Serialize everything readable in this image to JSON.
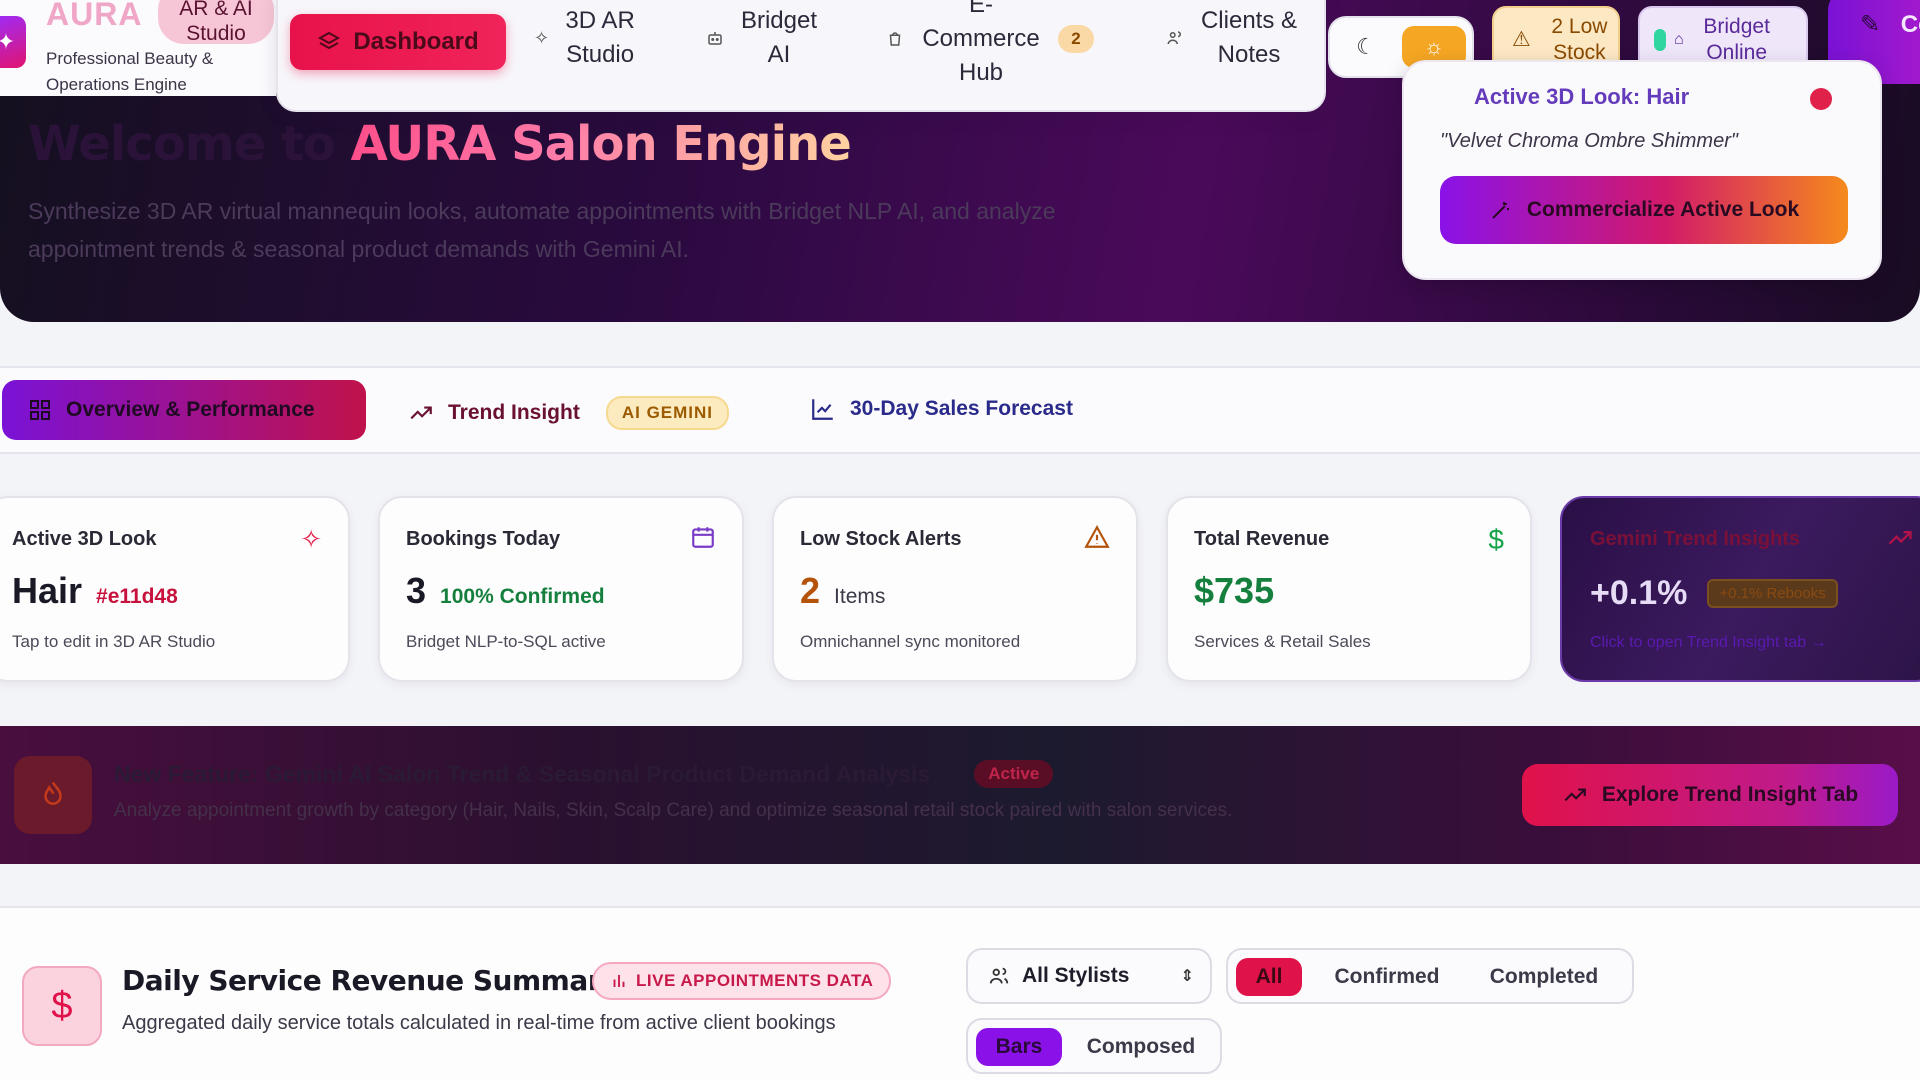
{
  "app": {
    "logo_text": "AURA",
    "studio_pill": "AR & AI Studio",
    "tagline": "Professional Beauty & Operations Engine"
  },
  "nav": {
    "items": [
      {
        "label": "Dashboard",
        "icon": "layers-icon",
        "active": true
      },
      {
        "label": "3D AR Studio",
        "icon": "sparkle-icon"
      },
      {
        "label": "Bridget AI",
        "icon": "bot-icon"
      },
      {
        "label": "E-Commerce Hub",
        "icon": "shopping-bag-icon",
        "badge": "2"
      },
      {
        "label": "Clients & Notes",
        "icon": "users-icon"
      }
    ]
  },
  "header_actions": {
    "low_stock": "2 Low Stock",
    "bridget_status": "Bridget Online",
    "corner_cta": "Co"
  },
  "hero": {
    "title_prefix": "Welcome to",
    "title_brand": "AURA Salon Engine",
    "subtitle": "Synthesize 3D AR virtual mannequin looks, automate appointments with Bridget NLP AI, and analyze appointment trends & seasonal product demands with Gemini AI."
  },
  "look_card": {
    "heading": "Active 3D Look: Hair",
    "quote": "\"Velvet Chroma Ombre Shimmer\"",
    "button": "Commercialize Active Look"
  },
  "tabs": {
    "overview": "Overview & Performance",
    "trend": "Trend Insight",
    "trend_badge": "AI GEMINI",
    "forecast": "30-Day Sales Forecast"
  },
  "cards": {
    "look": {
      "title": "Active 3D Look",
      "value": "Hair",
      "secondary": "#e11d48",
      "note": "Tap to edit in 3D AR Studio"
    },
    "bookings": {
      "title": "Bookings Today",
      "value": "3",
      "secondary": "100% Confirmed",
      "note": "Bridget NLP-to-SQL active"
    },
    "stock": {
      "title": "Low Stock Alerts",
      "value": "2",
      "secondary": "Items",
      "note": "Omnichannel sync monitored"
    },
    "revenue": {
      "title": "Total Revenue",
      "value": "$735",
      "note": "Services & Retail Sales"
    },
    "trend": {
      "title": "Gemini Trend Insights",
      "value": "+0.1%",
      "badge": "+0.1% Rebooks",
      "note": "Click to open Trend Insight tab →"
    }
  },
  "feature": {
    "title": "New Feature: Gemini AI Salon Trend & Seasonal Product Demand Analysis",
    "status": "Active",
    "subtitle": "Analyze appointment growth by category (Hair, Nails, Skin, Scalp Care) and optimize seasonal retail stock paired with salon services.",
    "button": "Explore Trend Insight Tab"
  },
  "revenue_section": {
    "title": "Daily Service Revenue Summary",
    "badge": "LIVE APPOINTMENTS DATA",
    "subtitle": "Aggregated daily service totals calculated in real-time from active client bookings",
    "stylist_filter": "All Stylists",
    "status_filters": [
      "All",
      "Confirmed",
      "Completed"
    ],
    "chart_modes": [
      "Bars",
      "Composed"
    ]
  },
  "colors": {
    "accent_pink": "#e11d48",
    "accent_purple": "#8a12e8",
    "success_green": "#16a34a",
    "warning_amber": "#f5a623"
  }
}
